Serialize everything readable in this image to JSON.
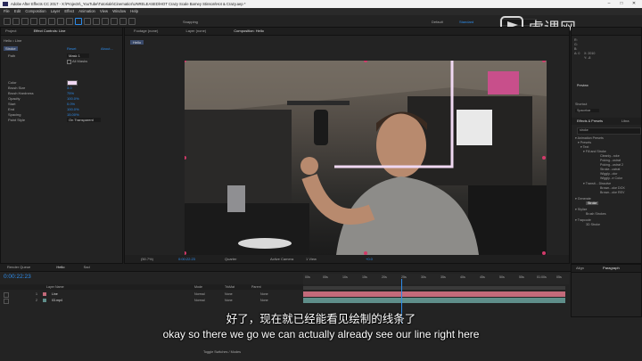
{
  "titlebar": {
    "title": "Adobe After Effects CC 2017 - X:\\Projects\\_YouTube\\Tutorials\\Cinematics\\UNRELEASED\\HOT Crazy Scale Barney Stinson\\Hot & Crazy.aep *"
  },
  "menu": [
    "File",
    "Edit",
    "Composition",
    "Layer",
    "Effect",
    "Animation",
    "View",
    "Window",
    "Help"
  ],
  "toolbar": {
    "snapping": "Snapping",
    "workspace_default": "Default",
    "workspace_standard": "Standard"
  },
  "project_panel": {
    "tabs": [
      "Project",
      "Effect Controls: Line"
    ],
    "breadcrumb": "Hello • Line",
    "effect_name": "Stroke",
    "reset": "Reset",
    "about": "About...",
    "properties": [
      {
        "label": "Path",
        "value": "Mask 1"
      },
      {
        "label": "All Masks",
        "value": ""
      },
      {
        "label": "Color",
        "value": ""
      },
      {
        "label": "Brush Size",
        "value": "3.0"
      },
      {
        "label": "Brush Hardness",
        "value": "75%"
      },
      {
        "label": "Opacity",
        "value": "100.0%"
      },
      {
        "label": "Start",
        "value": "0.0%"
      },
      {
        "label": "End",
        "value": "100.0%"
      },
      {
        "label": "Spacing",
        "value": "15.00%"
      },
      {
        "label": "Paint Style",
        "value": "On Transparent"
      }
    ]
  },
  "viewer": {
    "tabs": [
      "Footage (none)",
      "Layer (none)",
      "Composition: Hello"
    ],
    "comp_chip": "Hello",
    "zoom": "(50.7%)",
    "timecode": "0:00:22:23",
    "resolution": "Quarter",
    "camera": "Active Camera",
    "views": "1 View",
    "exposure": "+0.0"
  },
  "right_panel": {
    "info_lines": [
      "R:",
      "G:",
      "B:",
      "A: 0"
    ],
    "coords": [
      "X: 2010",
      "Y: -8"
    ],
    "preview_label": "Preview",
    "shortcut_label": "Shortcut",
    "shortcut_value": "Spacebar",
    "effects_tab": "Effects & Presets",
    "library_tab": "Libra",
    "search_value": "stroke",
    "tree": [
      "▾ Animation Presets",
      "▾ Presets",
      "▾ Text",
      "▾ Fill and Stroke",
      "Cleanly...roke",
      "Poking...ustrat",
      "Poking...ustrat 2",
      "Stroke...ustrat",
      "Wiggly...olor",
      "Wiggly...e Color",
      "▾ Transit... Dissolve",
      "Brown...oke DOX",
      "Brown...oke REV",
      "▾ Generate",
      "Stroke",
      "▾ Stylize",
      "Brush Strokes",
      "▾ Trapcode",
      "3D Stroke"
    ],
    "align_label": "Paragraph",
    "para_tab": "Align"
  },
  "timeline": {
    "tabs": [
      "Render Queue",
      "Hello",
      "Sad"
    ],
    "timecode": "0:00:22:23",
    "columns": [
      "Layer Name",
      "Mode",
      "TrkMat",
      "Parent"
    ],
    "layers": [
      {
        "num": "1",
        "name": "Line",
        "mode": "Normal",
        "trkmat": "None",
        "parent": "None"
      },
      {
        "num": "2",
        "name": "03.mp4",
        "mode": "Normal",
        "trkmat": "None",
        "parent": "None"
      }
    ],
    "ruler": [
      "00s",
      "05s",
      "10s",
      "15s",
      "20s",
      "25s",
      "30s",
      "35s",
      "40s",
      "45s",
      "50s",
      "55s",
      "01:00s",
      "05s"
    ],
    "footer": "Toggle Switches / Modes"
  },
  "watermark": {
    "cn": "虎课网"
  },
  "subtitles": {
    "cn": "好了，现在就已经能看见绘制的线条了",
    "en": "okay so there we go we can actually already see our line right here"
  },
  "colors": {
    "accent": "#2d8ceb",
    "layer_line": "#c36a7a",
    "layer_video": "#5f8e8a",
    "stroke": "#f0d8f2"
  }
}
